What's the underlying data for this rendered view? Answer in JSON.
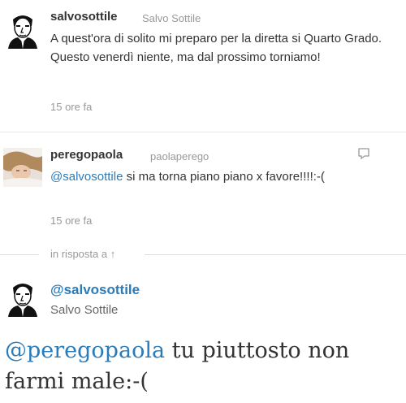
{
  "tweet1": {
    "username": "salvosottile",
    "fullname": "Salvo Sottile",
    "text": "A quest'ora di solito mi preparo per la diretta si Quarto Grado. Questo venerdì niente, ma dal prossimo torniamo!",
    "time": "15 ore fa"
  },
  "tweet2": {
    "username": "peregopaola",
    "fullname": "paolaperego",
    "mention": "@salvosottile",
    "text_rest": " si ma torna piano piano x favore!!!!:-(",
    "time": "15 ore fa"
  },
  "in_reply": {
    "label": "in risposta a ↑"
  },
  "main_tweet": {
    "handle": "@salvosottile",
    "fullname": "Salvo Sottile",
    "mention": "@peregopaola",
    "text_rest": " tu piuttosto non farmi male:-("
  },
  "colors": {
    "link": "#2b7bb9",
    "muted": "#999999"
  }
}
